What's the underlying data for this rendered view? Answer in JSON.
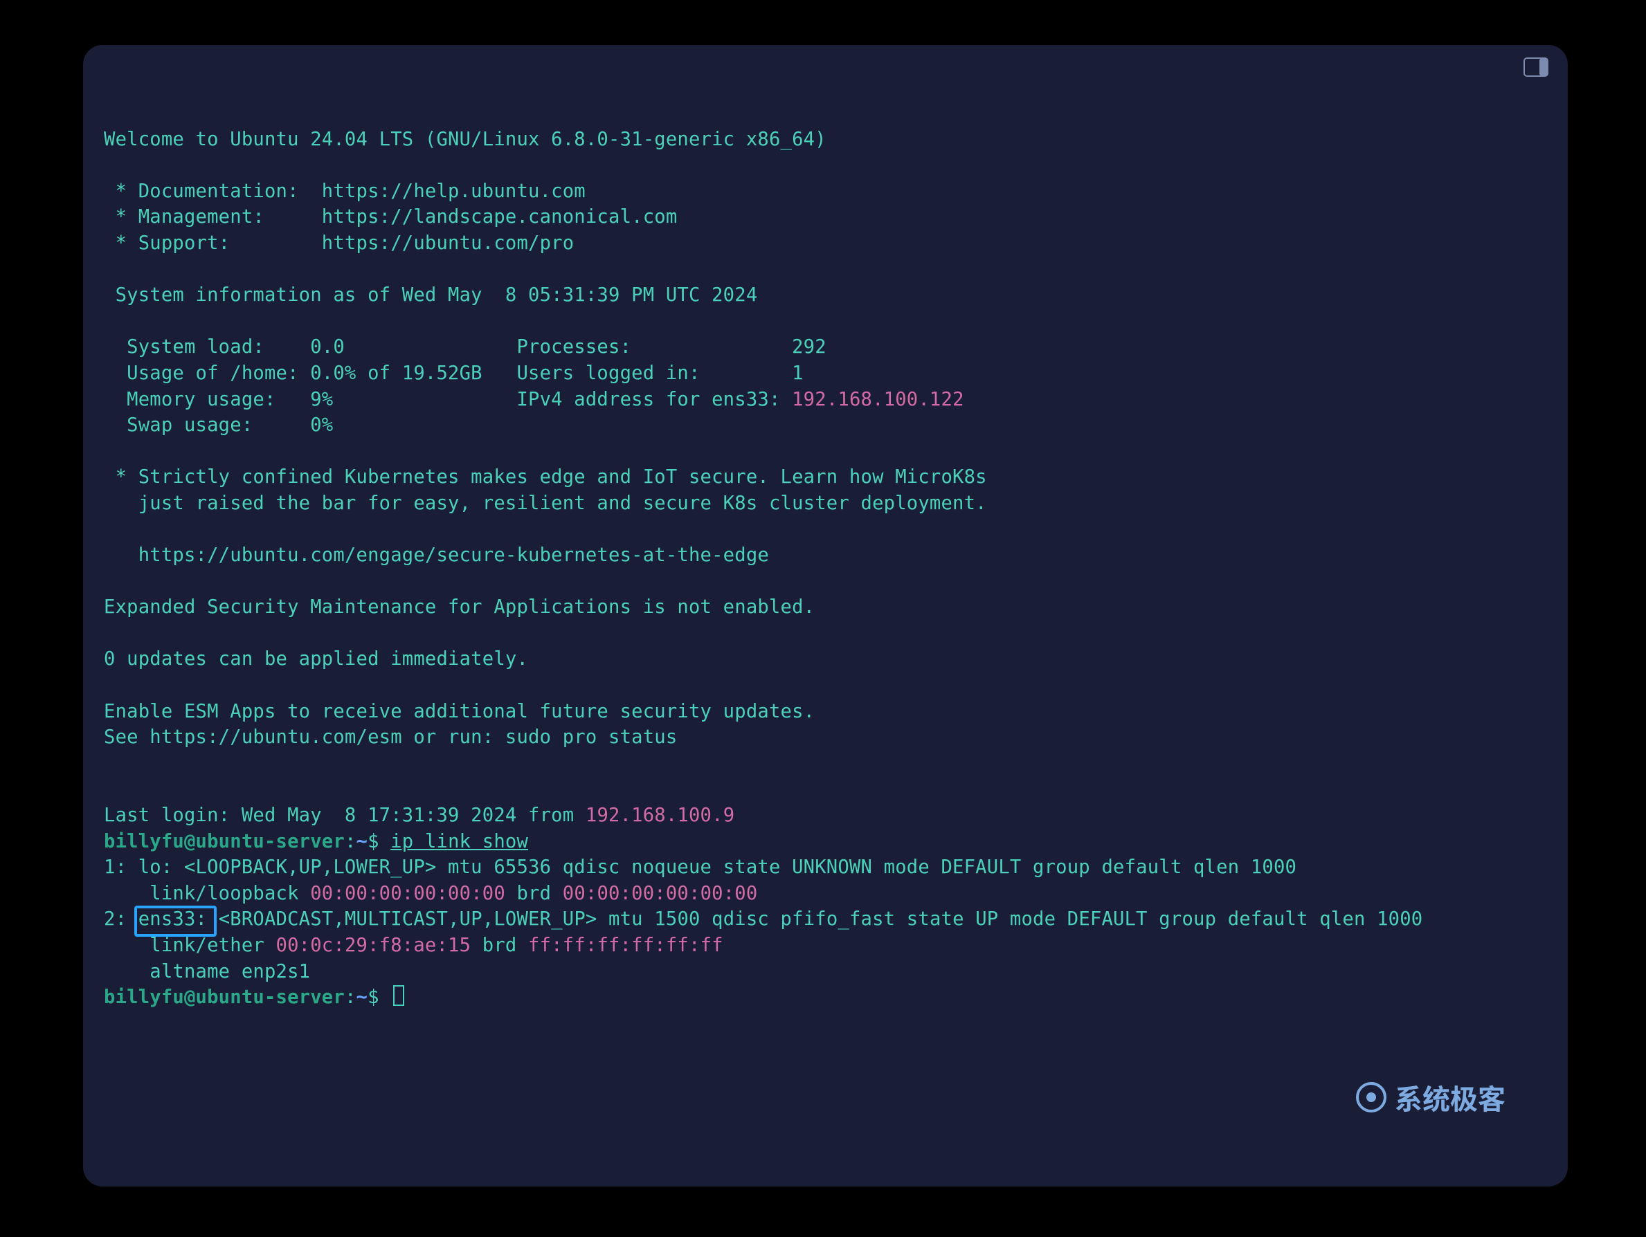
{
  "motd": {
    "welcome": "Welcome to Ubuntu 24.04 LTS (GNU/Linux 6.8.0-31-generic x86_64)",
    "doc_label": " * Documentation:  ",
    "doc_url": "https://help.ubuntu.com",
    "mgmt_label": " * Management:     ",
    "mgmt_url": "https://landscape.canonical.com",
    "sup_label": " * Support:        ",
    "sup_url": "https://ubuntu.com/pro",
    "sysinfo_hdr": " System information as of Wed May  8 05:31:39 PM UTC 2024",
    "row1": "  System load:    0.0               Processes:              292",
    "row2": "  Usage of /home: 0.0% of 19.52GB   Users logged in:        1",
    "row3a": "  Memory usage:   9%                IPv4 address for ens33: ",
    "row3b": "192.168.100.122",
    "row4": "  Swap usage:     0%",
    "k8s1": " * Strictly confined Kubernetes makes edge and IoT secure. Learn how MicroK8s",
    "k8s2": "   just raised the bar for easy, resilient and secure K8s cluster deployment.",
    "k8s_url": "   https://ubuntu.com/engage/secure-kubernetes-at-the-edge",
    "esm1": "Expanded Security Maintenance for Applications is not enabled.",
    "upd": "0 updates can be applied immediately.",
    "esm2": "Enable ESM Apps to receive additional future security updates.",
    "esm3": "See https://ubuntu.com/esm or run: sudo pro status",
    "last_login_a": "Last login: Wed May  8 17:31:39 2024 from ",
    "last_login_b": "192.168.100.9"
  },
  "prompt": {
    "userhost": "billyfu@ubuntu-server",
    "colon": ":",
    "path": "~",
    "sym": "$ "
  },
  "cmd1": "ip link show",
  "out": {
    "l1a": "1: lo: <LOOPBACK,UP,LOWER_UP> mtu 65536 qdisc noqueue state UNKNOWN mode DEFAULT group default qlen 1000",
    "l1b_a": "    link/loopback ",
    "l1b_b": "00:00:00:00:00:00",
    "l1b_c": " brd ",
    "l1b_d": "00:00:00:00:00:00",
    "l2a_pre": "2: ",
    "l2a_name": "ens33:",
    "l2a_post": " <BROADCAST,MULTICAST,UP,LOWER_UP> mtu 1500 qdisc pfifo_fast state UP mode DEFAULT group default qlen 1000",
    "l2b_a": "    link/ether ",
    "l2b_b": "00:0c:29:f8:ae:15",
    "l2b_c": " brd ",
    "l2b_d": "ff:ff:ff:ff:ff:ff",
    "l2c": "    altname enp2s1"
  },
  "watermark": "系统极客"
}
